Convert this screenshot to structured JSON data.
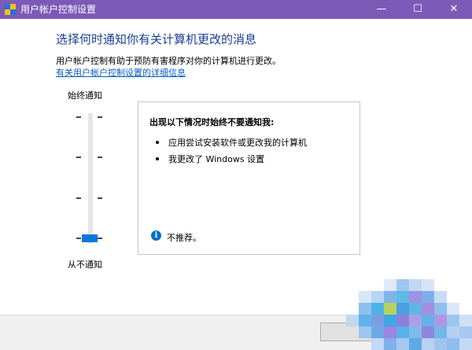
{
  "window": {
    "title": "用户帐户控制设置",
    "minimize_glyph": "—",
    "maximize_glyph": "☐",
    "close_glyph": "✕",
    "title_bar_color": "#7d5ab8",
    "app_icon": "uac-shield-icon"
  },
  "main": {
    "heading": "选择何时通知你有关计算机更改的消息",
    "description": "用户帐户控制有助于预防有害程序对你的计算机进行更改。",
    "link": "有关用户帐户控制设置的详细信息"
  },
  "slider": {
    "top_label": "始终通知",
    "bottom_label": "从不通知",
    "levels": 4,
    "selected_level": 1,
    "thumb_color": "#0a78d7"
  },
  "panel": {
    "title": "出现以下情况时始终不要通知我:",
    "bullets": [
      "应用尝试安装软件或更改我的计算机",
      "我更改了 Windows 设置"
    ],
    "recommendation": "不推荐。",
    "info_icon": "info-icon"
  }
}
